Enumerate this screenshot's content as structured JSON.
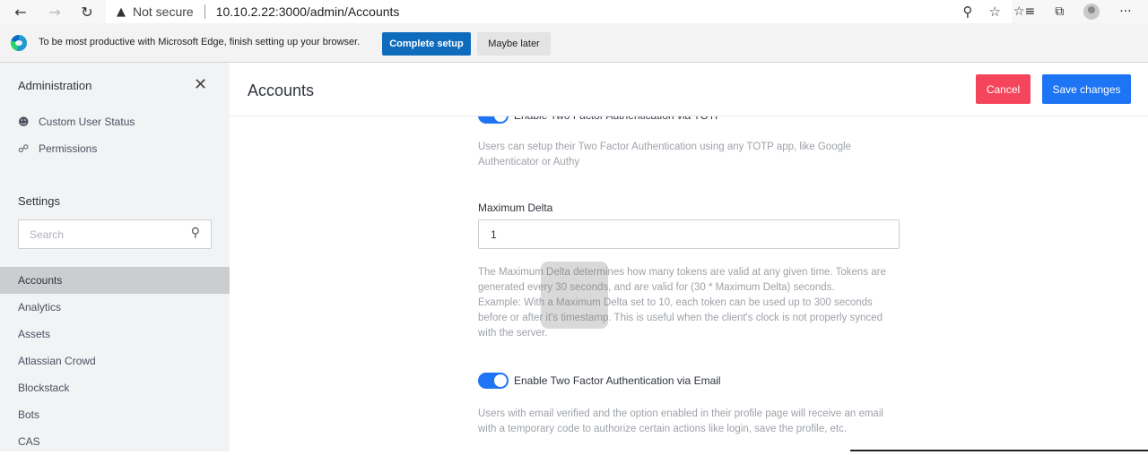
{
  "browser": {
    "security_label": "Not secure",
    "url": "10.10.2.22:3000/admin/Accounts"
  },
  "infobar": {
    "message": "To be most productive with Microsoft Edge, finish setting up your browser.",
    "complete_label": "Complete setup",
    "later_label": "Maybe later"
  },
  "sidebar": {
    "title": "Administration",
    "links": [
      {
        "label": "Custom User Status",
        "icon": "person-icon"
      },
      {
        "label": "Permissions",
        "icon": "lock-icon"
      }
    ],
    "settings_heading": "Settings",
    "search_placeholder": "Search",
    "items": [
      {
        "label": "Accounts",
        "active": true
      },
      {
        "label": "Analytics"
      },
      {
        "label": "Assets"
      },
      {
        "label": "Atlassian Crowd"
      },
      {
        "label": "Blockstack"
      },
      {
        "label": "Bots"
      },
      {
        "label": "CAS"
      }
    ]
  },
  "header": {
    "title": "Accounts",
    "cancel_label": "Cancel",
    "save_label": "Save changes"
  },
  "settings": {
    "totp_toggle_label": "Enable Two Factor Authentication via TOTP",
    "totp_hint": "Users can setup their Two Factor Authentication using any TOTP app, like Google Authenticator or Authy",
    "max_delta_label": "Maximum Delta",
    "max_delta_value": "1",
    "max_delta_hint_1": "The Maximum Delta determines how many tokens are valid at any given time. Tokens are generated every 30 seconds, and are valid for (30 * Maximum Delta) seconds.",
    "max_delta_hint_2": "Example: With a Maximum Delta set to 10, each token can be used up to 300 seconds before or after it's timestamp. This is useful when the client's clock is not properly synced with the server.",
    "email_toggle_label": "Enable Two Factor Authentication via Email",
    "email_hint": "Users with email verified and the option enabled in their profile page will receive an email with a temporary code to authorize certain actions like login, save the profile, etc."
  },
  "colors": {
    "primary": "#1d74f5",
    "danger": "#f5455c",
    "sidebar_bg": "#f2f3f5",
    "edge_blue": "#0f6cbd"
  }
}
